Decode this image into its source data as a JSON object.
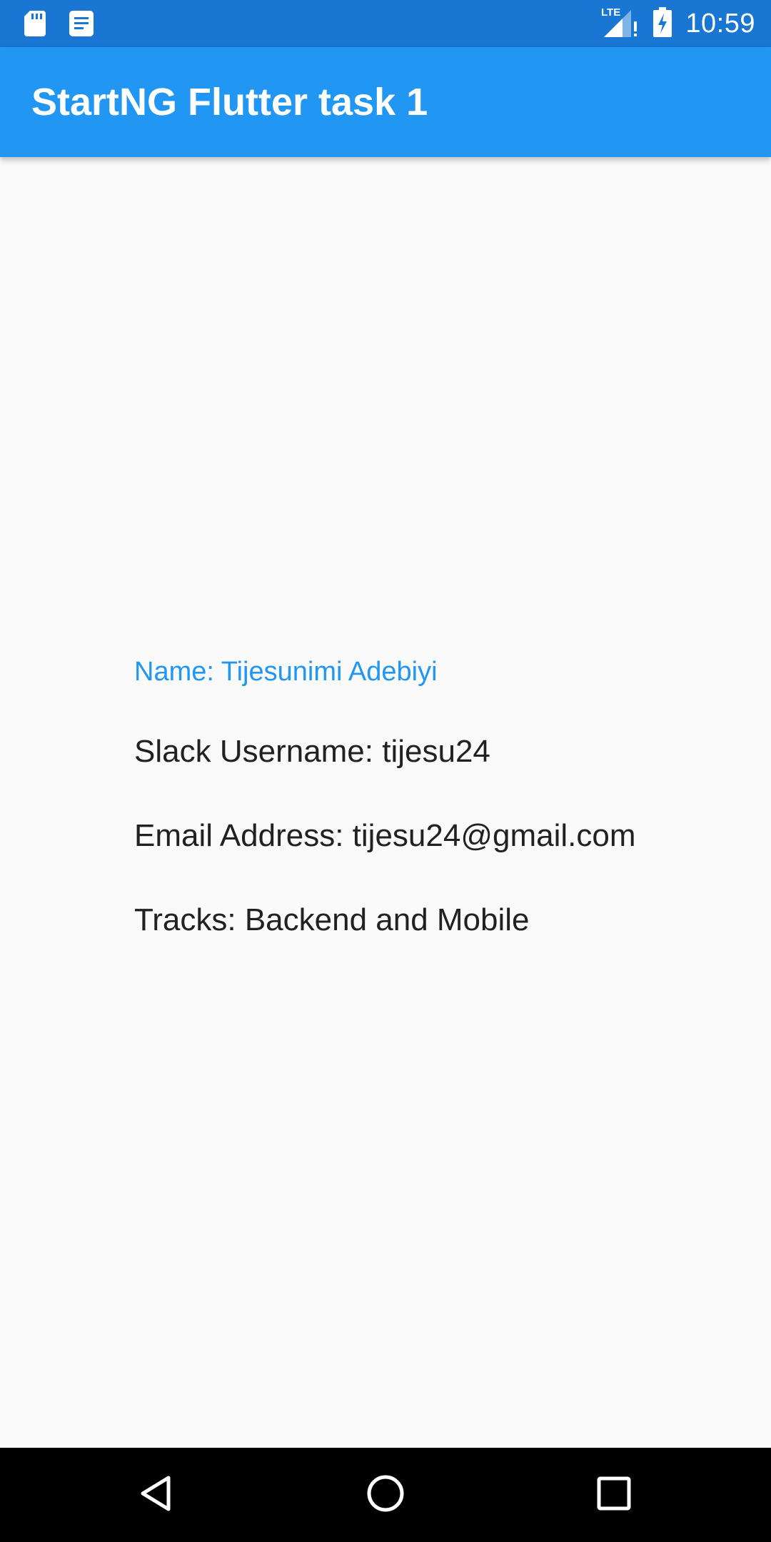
{
  "status_bar": {
    "time": "10:59",
    "network_label": "LTE",
    "left_icons": [
      "sd-card-icon",
      "notes-notification-icon"
    ],
    "right_icons": [
      "lte-signal-icon",
      "battery-charging-icon"
    ]
  },
  "app_bar": {
    "title": "StartNG Flutter task 1",
    "color": "#2196f3"
  },
  "profile": {
    "name_line": "Name: Tijesunimi Adebiyi",
    "slack_line": "Slack Username: tijesu24",
    "email_line": "Email Address: tijesu24@gmail.com",
    "tracks_line": "Tracks: Backend and Mobile",
    "accent_color": "#2196f3",
    "text_color": "#212121"
  },
  "nav_bar": {
    "icons": [
      "back-icon",
      "home-icon",
      "recents-icon"
    ]
  }
}
